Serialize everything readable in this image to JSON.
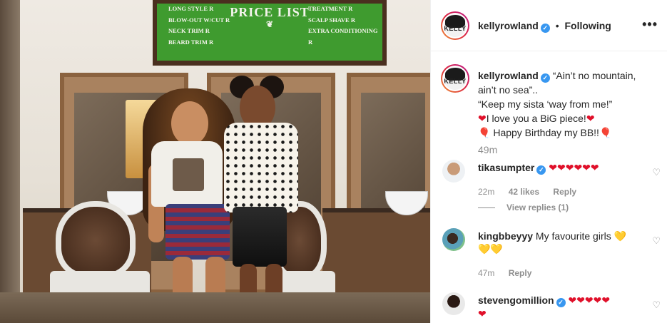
{
  "photo": {
    "sign": {
      "title": "PRICE LIST",
      "flourish": "❦",
      "left_items": [
        "LONG STYLE R",
        "BLOW-OUT W/CUT R",
        "NECK TRIM R",
        "BEARD TRIM R"
      ],
      "right_items": [
        "TREATMENT R",
        "SCALP SHAVE R",
        "EXTRA CONDITIONING R"
      ]
    }
  },
  "header": {
    "avatar_text": "KELLY",
    "username": "kellyrowland",
    "verified_mark": "✓",
    "separator": "•",
    "follow_state": "Following",
    "more_icon": "•••"
  },
  "caption": {
    "username": "kellyrowland",
    "lines": [
      "“Ain’t no mountain,",
      "ain’t no sea”..",
      "“Keep my sista ‘way from me!”",
      "I love you a BiG piece!",
      "Happy Birthday my BB!!"
    ],
    "time": "49m"
  },
  "comments": [
    {
      "username": "tikasumpter",
      "text": "❤❤❤❤❤❤",
      "time": "22m",
      "likes": "42 likes",
      "reply": "Reply",
      "view_replies": "View replies (1)"
    },
    {
      "username": "kingbbeyyy",
      "text": "My favourite girls",
      "text_emoji": "💛",
      "text_emoji_line2": "💛💛",
      "time": "47m",
      "reply": "Reply"
    },
    {
      "username": "stevengomillion",
      "text": "❤❤❤❤❤",
      "text_line2": "❤"
    }
  ],
  "icons": {
    "heart_outline": "♡",
    "heart_red": "❤",
    "balloon": "🎈"
  },
  "colors": {
    "verified": "#3897f0",
    "secondary_text": "#8e8e8e",
    "heart": "#e0102a",
    "sign_green": "#3f9b2f"
  }
}
